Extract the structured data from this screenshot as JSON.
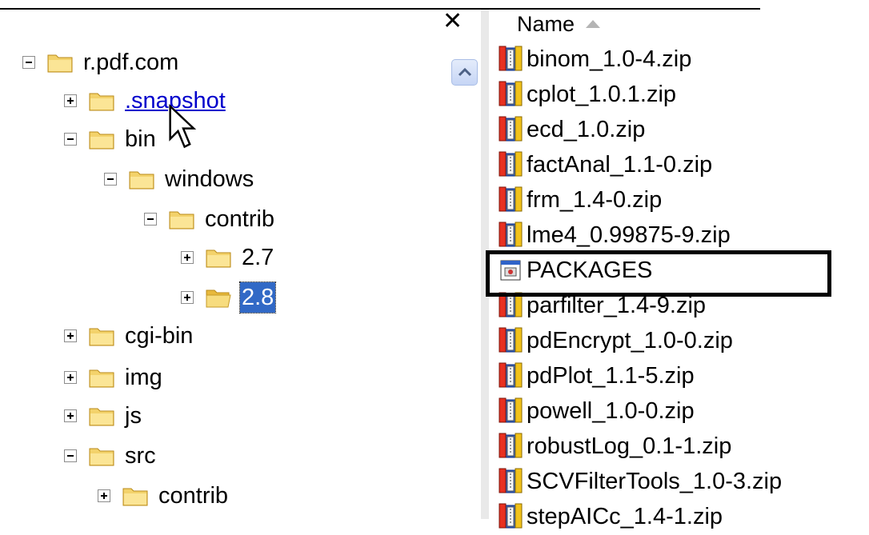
{
  "tree": {
    "close_glyph": "✕",
    "nodes": [
      {
        "label": "r.pdf.com",
        "expander": "minus"
      },
      {
        "label": ".snapshot",
        "expander": "plus"
      },
      {
        "label": "bin",
        "expander": "minus"
      },
      {
        "label": "windows",
        "expander": "minus"
      },
      {
        "label": "contrib",
        "expander": "minus"
      },
      {
        "label": "2.7",
        "expander": "plus"
      },
      {
        "label": "2.8",
        "expander": "plus",
        "selected": true
      },
      {
        "label": "cgi-bin",
        "expander": "plus"
      },
      {
        "label": "img",
        "expander": "plus"
      },
      {
        "label": "js",
        "expander": "plus"
      },
      {
        "label": "src",
        "expander": "minus"
      },
      {
        "label": "contrib",
        "expander": "plus"
      }
    ]
  },
  "list": {
    "column_header": "Name",
    "sort": "ascending",
    "files": [
      {
        "name": "binom_1.0-4.zip",
        "icon": "winzip-icon"
      },
      {
        "name": "cplot_1.0.1.zip",
        "icon": "winzip-icon"
      },
      {
        "name": "ecd_1.0.zip",
        "icon": "winzip-icon"
      },
      {
        "name": "factAnal_1.1-0.zip",
        "icon": "winzip-icon"
      },
      {
        "name": "frm_1.4-0.zip",
        "icon": "winzip-icon"
      },
      {
        "name": "lme4_0.99875-9.zip",
        "icon": "winzip-icon"
      },
      {
        "name": "PACKAGES",
        "icon": "generic-file-icon",
        "highlighted": true
      },
      {
        "name": "parfilter_1.4-9.zip",
        "icon": "winzip-icon"
      },
      {
        "name": "pdEncrypt_1.0-0.zip",
        "icon": "winzip-icon"
      },
      {
        "name": "pdPlot_1.1-5.zip",
        "icon": "winzip-icon"
      },
      {
        "name": "powell_1.0-0.zip",
        "icon": "winzip-icon"
      },
      {
        "name": "robustLog_0.1-1.zip",
        "icon": "winzip-icon"
      },
      {
        "name": "SCVFilterTools_1.0-3.zip",
        "icon": "winzip-icon"
      },
      {
        "name": "stepAICc_1.4-1.zip",
        "icon": "winzip-icon"
      }
    ]
  },
  "colors": {
    "selection": "#3169c6",
    "link": "#0000cc",
    "folder": "#f3d26b"
  }
}
